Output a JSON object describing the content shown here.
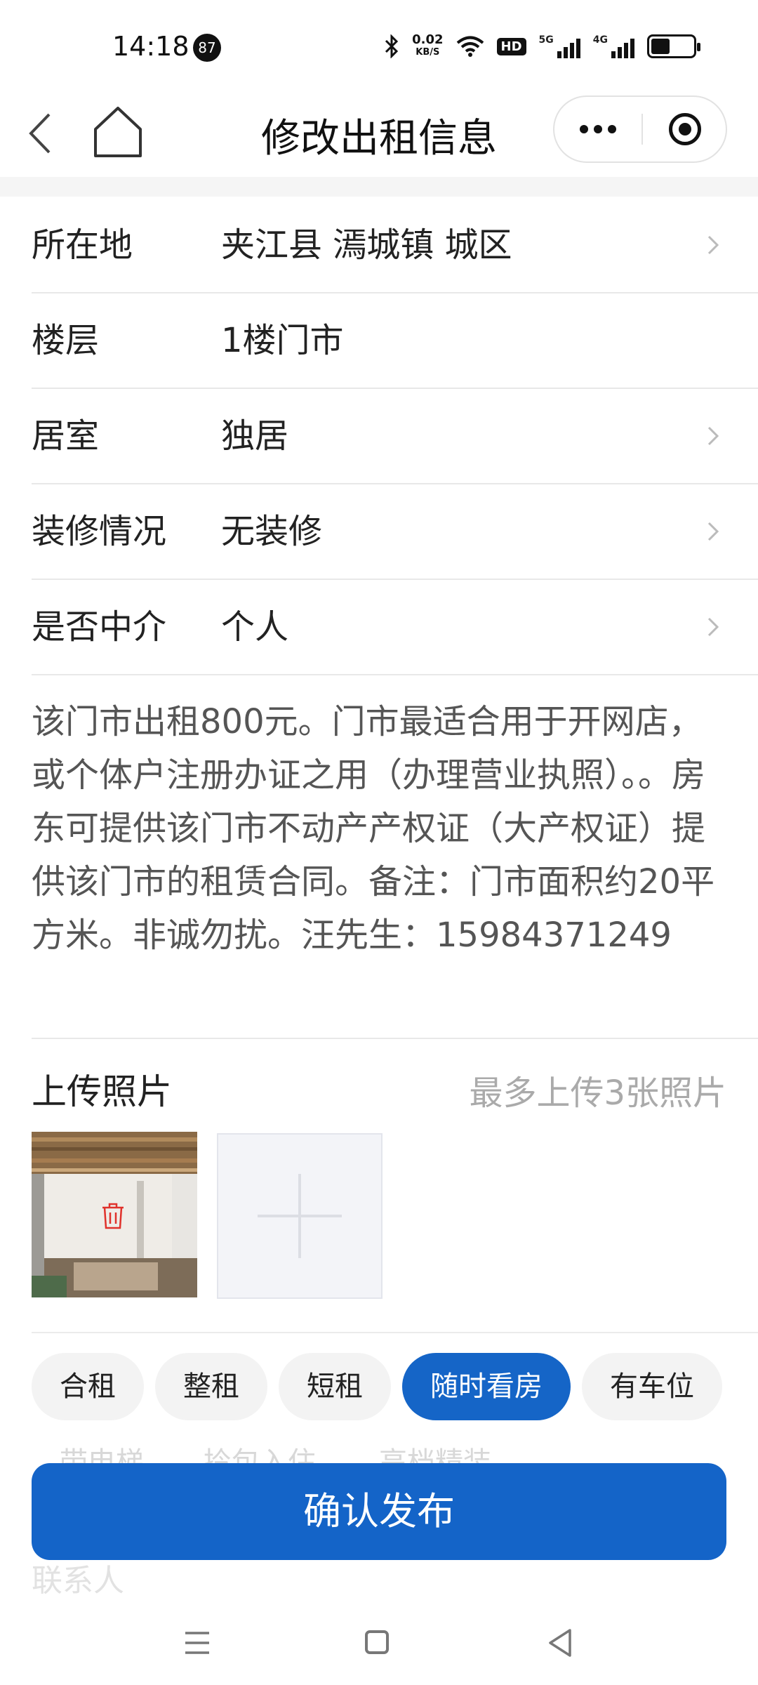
{
  "status_bar": {
    "time": "14:18",
    "notification_count": "87",
    "speed_value": "0.02",
    "speed_unit": "KB/S",
    "hd_label": "HD",
    "sim1_label": "5G",
    "sim2_label": "4G",
    "battery_level": 0.45,
    "icons": [
      "bluetooth-icon",
      "wifi-icon",
      "signal-icon",
      "battery-icon"
    ]
  },
  "header": {
    "title": "修改出租信息"
  },
  "form": {
    "rows": [
      {
        "label": "所在地",
        "value": "夹江县 漹城镇 城区",
        "has_arrow": true
      },
      {
        "label": "楼层",
        "value": "1楼门市",
        "has_arrow": false
      },
      {
        "label": "居室",
        "value": "独居",
        "has_arrow": true
      },
      {
        "label": "装修情况",
        "value": "无装修",
        "has_arrow": true
      },
      {
        "label": "是否中介",
        "value": "个人",
        "has_arrow": true
      }
    ],
    "description": "该门市出租800元。门市最适合用于开网店，或个体户注册办证之用（办理营业执照）。。房东可提供该门市不动产产权证（大产权证）提供该门市的租赁合同。备注：门市面积约20平方米。非诚勿扰。汪先生：15984371249"
  },
  "upload": {
    "title": "上传照片",
    "hint": "最多上传3张照片"
  },
  "tags": [
    {
      "label": "合租",
      "active": false
    },
    {
      "label": "整租",
      "active": false
    },
    {
      "label": "短租",
      "active": false
    },
    {
      "label": "随时看房",
      "active": true
    },
    {
      "label": "有车位",
      "active": false
    }
  ],
  "faded_tags": [
    "带电梯",
    "拎包入住",
    "高档精装"
  ],
  "faded_contact": "联系人",
  "publish_button": "确认发布",
  "colors": {
    "accent": "#1464c8",
    "delete_icon": "#e0312b"
  }
}
